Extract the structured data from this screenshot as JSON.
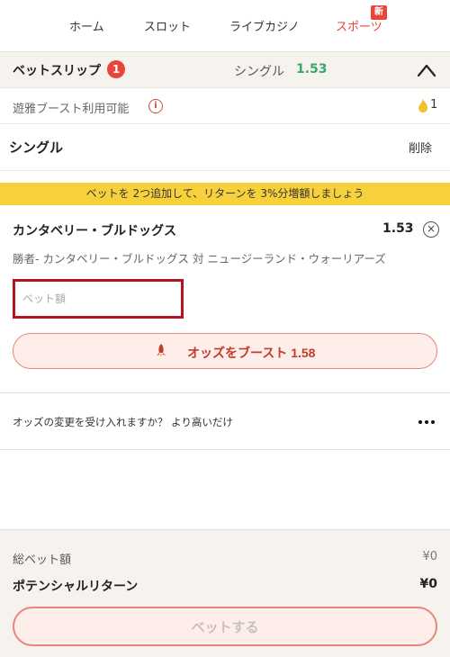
{
  "nav": {
    "items": [
      {
        "label": "ホーム"
      },
      {
        "label": "スロット"
      },
      {
        "label": "ライブカジノ"
      },
      {
        "label": "スポーツ"
      }
    ],
    "new_badge": "新",
    "active_color": "#e8463a"
  },
  "betslip": {
    "title": "ベットスリップ",
    "count": "1",
    "mode": "シングル",
    "total_odds": "1.53"
  },
  "boost": {
    "label": "遊雅ブースト利用可能",
    "info_icon": "i",
    "available": "1"
  },
  "single": {
    "label": "シングル",
    "delete_label": "削除"
  },
  "promo": {
    "text": "ベットを 2つ追加して、リターンを 3%分増額しましょう"
  },
  "selection": {
    "name": "カンタベリー・ブルドッグス",
    "odds": "1.53",
    "remove_icon": "×",
    "market": "勝者- カンタベリー・ブルドッグス 対 ニュージーランド・ウォーリアーズ",
    "stake_placeholder": "ベット額",
    "boost_button": "オッズをブースト 1.58"
  },
  "odds_change": {
    "label": "オッズの変更を受け入れますか？ より高いだけ"
  },
  "summary": {
    "total_label": "総ベット額",
    "total_value": "¥0",
    "return_label": "ポテンシャルリターン",
    "return_value": "¥0",
    "place_button": "ベットする"
  }
}
